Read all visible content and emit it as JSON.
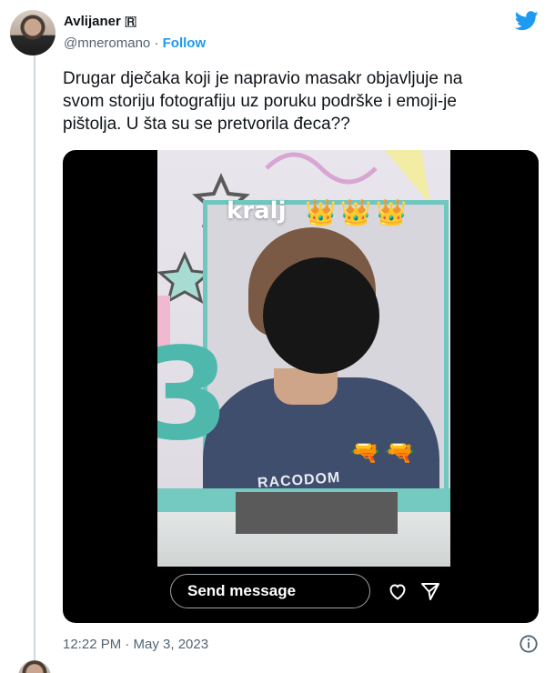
{
  "tweet": {
    "author": {
      "display_name": "Avlijaner 🇷",
      "handle": "@mneromano",
      "separator": " · ",
      "follow_label": "Follow"
    },
    "text": "Drugar dječaka koji je napravio masakr objavljuje na\nsvom storiju fotografiju uz poruku podrške i emoji-je\npištolja. U šta su se pretvorila đeca??",
    "timestamp": "12:22 PM · May 3, 2023"
  },
  "media": {
    "story_label": "kralj",
    "crown_emojis": [
      "👑",
      "👑",
      "👑"
    ],
    "gun_emojis": [
      "🔫",
      "🔫"
    ],
    "shirt_text": "RACODOM",
    "big_digit": "3",
    "send_message_label": "Send message"
  },
  "icons": {
    "brand": "twitter-bird-icon",
    "like": "heart-icon",
    "share": "send-icon",
    "info": "info-icon"
  },
  "colors": {
    "accent": "#1d9bf0",
    "text": "#0f1419",
    "muted": "#536471",
    "divider": "#cfd9de"
  }
}
